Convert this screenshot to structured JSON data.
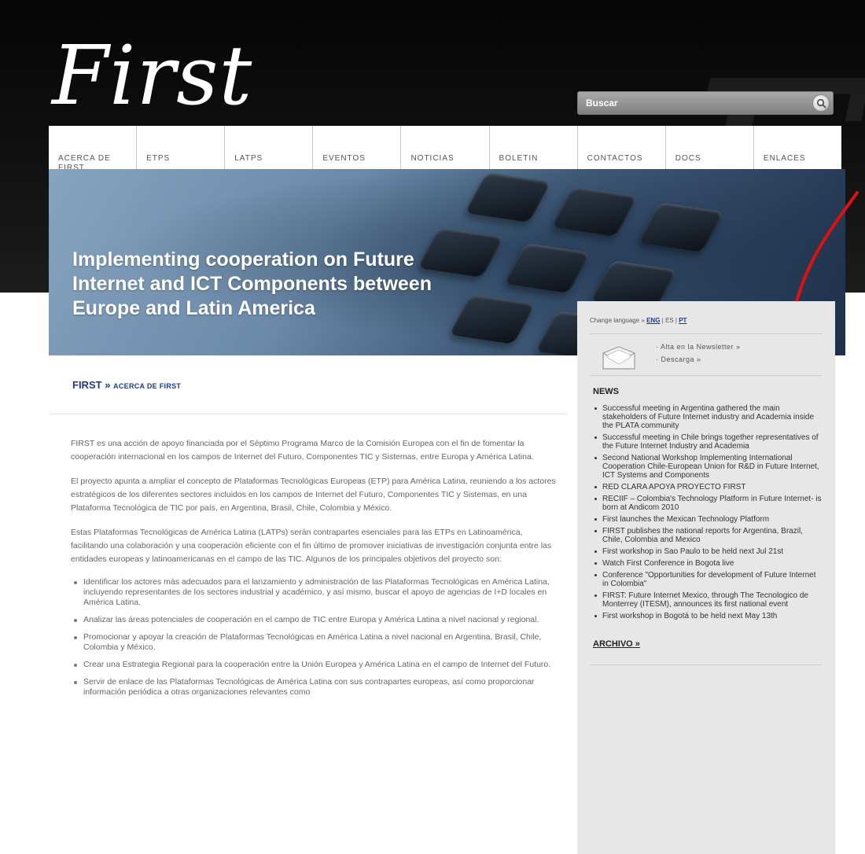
{
  "header": {
    "logo": "First",
    "watermark": "First",
    "search_placeholder": "Buscar"
  },
  "nav": {
    "items": [
      "ACERCA DE FIRST",
      "ETPS",
      "LATPS",
      "EVENTOS",
      "NOTICIAS",
      "BOLETIN",
      "CONTACTOS",
      "DOCS",
      "ENLACES"
    ]
  },
  "banner": {
    "title": "Implementing cooperation on Future Internet and ICT Components between Europe and Latin America"
  },
  "breadcrumb": {
    "root": "FIRST",
    "sep": "»",
    "current": "ACERCA DE FIRST"
  },
  "main": {
    "paragraphs": [
      "FIRST es una acción de apoyo financiada por el Séptimo Programa Marco de la Comisión Europea con el fin de fomentar la cooperación internacional en los campos de Internet del Futuro, Componentes TIC y Sistemas, entre Europa y América Latina.",
      "El proyecto apunta a ampliar el concepto de Plataformas Tecnológicas Europeas (ETP) para América Latina, reuniendo a los actores estratégicos de los diferentes sectores incluidos en los campos de Internet del Futuro, Componentes TIC y Sistemas, en una Plataforma Tecnológica de TIC por país, en Argentina, Brasil, Chile, Colombia y México.",
      "Estas Plataformas Tecnológicas de América Latina (LATPs) serán contrapartes esenciales para las ETPs en Latinoamérica, facilitando una colaboración y una cooperación eficiente con el fin último de promover iniciativas de investigación conjunta entre las entidades europeas y latinoamericanas en el campo de las TIC. Algunos de los principales objetivos del proyecto son:"
    ],
    "objectives": [
      "Identificar los actores más adecuados para el lanzamiento y administración de las Plataformas Tecnológicas en América Latina, incluyendo representantes de los sectores industrial y académico, y así mismo, buscar el apoyo de agencias de I+D locales en América Latina.",
      "Analizar las áreas potenciales de cooperación en el campo de TIC entre Europa y América Latina a nivel nacional y regional.",
      "Promocionar y apoyar la creación de Plataformas Tecnológicas en América Latina a nivel nacional en Argentina, Brasil, Chile, Colombia y México.",
      "Crear una Estrategia Regional para la cooperación entre la Unión Europea y América Latina en el campo de Internet del Futuro.",
      "Servir de enlace de las Plataformas Tecnológicas de América Latina con sus contrapartes europeas, así como proporcionar información periódica a otras organizaciones relevantes como"
    ]
  },
  "sidebar": {
    "lang_prefix": "Change language »",
    "lang_eng": "ENG",
    "lang_es": "ES",
    "lang_pt": "PT",
    "lang_sep": "|",
    "newsletter_signup": "· Alta en la Newsletter »",
    "newsletter_download": "· Descarga »",
    "news_title": "NEWS",
    "news": [
      "Successful meeting in Argentina gathered the main stakeholders of Future Internet industry and Academia inside the PLATA community",
      "Successful meeting in Chile brings together representatives of the Future Internet Industry and Academia",
      "Second National Workshop Implementing International Cooperation Chile-European Union for R&D in Future Internet, ICT Systems and Components",
      "RED CLARA APOYA PROYECTO FIRST",
      "RECIIF – Colombia's Technology Platform in Future Internet- is born at Andicom 2010",
      "First launches the Mexican Technology Platform",
      "FIRST publishes the national reports for Argentina, Brazil, Chile, Colombia and Mexico",
      "First workshop in Sao Paulo to be held next Jul 21st",
      "Watch First Conference in Bogota live",
      "Conference \"Opportunities for development of Future Internet in Colombia\"",
      "FIRST: Future Internet Mexico, through The Tecnologico de Monterrey (ITESM), announces its first national event",
      "First workshop in Bogotá to be held next May 13th"
    ],
    "archive": "ARCHIVO »"
  },
  "colors": {
    "breadcrumb": "#1e3a8a",
    "arrow": "#e01010",
    "sidebar_bg": "#e7e7e7"
  }
}
